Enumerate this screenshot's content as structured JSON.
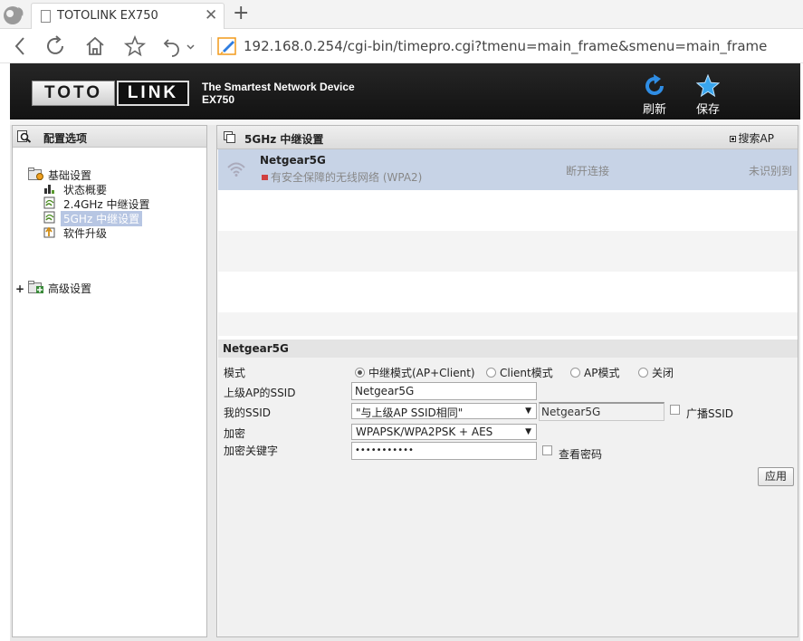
{
  "browser": {
    "tab_title": "TOTOLINK EX750",
    "tab_close": "✕",
    "new_tab": "+",
    "url": "192.168.0.254/cgi-bin/timepro.cgi?tmenu=main_frame&smenu=main_frame"
  },
  "header": {
    "logo_left": "TOTO",
    "logo_right": "LINK",
    "tagline": "The Smartest Network Device",
    "model": "EX750",
    "refresh_label": "刷新",
    "save_label": "保存"
  },
  "sidebar": {
    "title": "配置选项",
    "expand": "+",
    "groups": [
      {
        "label": "基础设置",
        "items": [
          {
            "label": "状态概要",
            "icon": "status-chart-icon"
          },
          {
            "label": "2.4GHz 中继设置",
            "icon": "wifi-doc-icon"
          },
          {
            "label": "5GHz 中继设置",
            "icon": "wifi-doc-icon",
            "active": true
          },
          {
            "label": "软件升级",
            "icon": "upgrade-icon"
          }
        ]
      },
      {
        "label": "高级设置",
        "items": []
      }
    ]
  },
  "main": {
    "title": "5GHz 中继设置",
    "search_label": "搜索AP",
    "ap_list": [
      {
        "ssid": "Netgear5G",
        "security": "有安全保障的无线网络 (WPA2)",
        "status": "断开连接",
        "ident": "未识别到"
      }
    ]
  },
  "detail": {
    "title": "Netgear5G",
    "mode_label": "模式",
    "modes": [
      "中继模式(AP+Client)",
      "Client模式",
      "AP模式",
      "关闭"
    ],
    "selected_mode": "中继模式(AP+Client)",
    "upper_ssid_label": "上级AP的SSID",
    "upper_ssid_value": "Netgear5G",
    "my_ssid_label": "我的SSID",
    "my_ssid_select": "\"与上级AP SSID相同\"",
    "my_ssid_mirror": "Netgear5G",
    "broadcast_label": "广播SSID",
    "encrypt_label": "加密",
    "encrypt_value": "WPAPSK/WPA2PSK + AES",
    "key_label": "加密关键字",
    "key_value": "•••••••••••",
    "show_pwd_label": "查看密码",
    "apply_label": "应用"
  },
  "colors": {
    "header_bg": "#1c1c1c",
    "selected_row": "#c7d3e6",
    "active_tree_item": "#b7c6e3",
    "refresh_icon": "#2f8de4",
    "save_icon": "#39a6ee"
  }
}
